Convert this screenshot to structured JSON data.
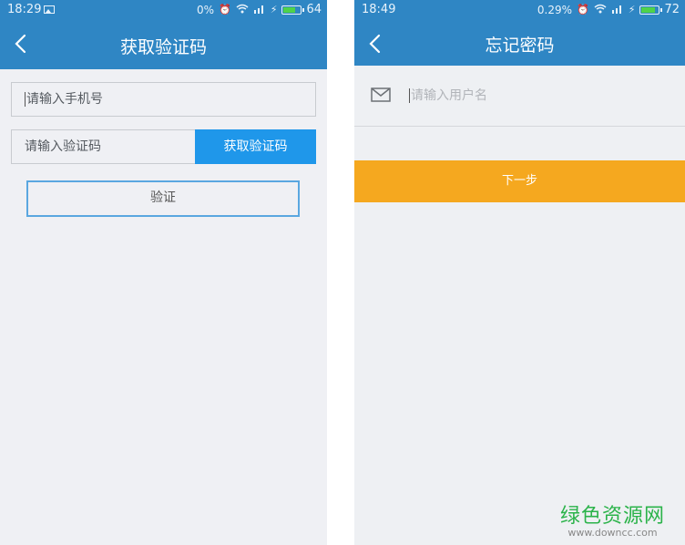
{
  "left_screen": {
    "status": {
      "time": "18:29",
      "battery_percent_text": "0%",
      "battery_level": "64"
    },
    "title": "获取验证码",
    "phone_placeholder": "请输入手机号",
    "code_placeholder": "请输入验证码",
    "get_code_button": "获取验证码",
    "verify_button": "验证"
  },
  "right_screen": {
    "status": {
      "time": "18:49",
      "battery_percent_text": "0.29%",
      "battery_level": "72"
    },
    "title": "忘记密码",
    "username_placeholder": "请输入用户名",
    "next_button": "下一步"
  },
  "watermark": {
    "name": "绿色资源网",
    "url": "www.downcc.com"
  },
  "colors": {
    "header_blue": "#2f86c4",
    "button_blue": "#1f97ea",
    "next_orange": "#f5a81f",
    "watermark_green": "#2bb34a"
  }
}
